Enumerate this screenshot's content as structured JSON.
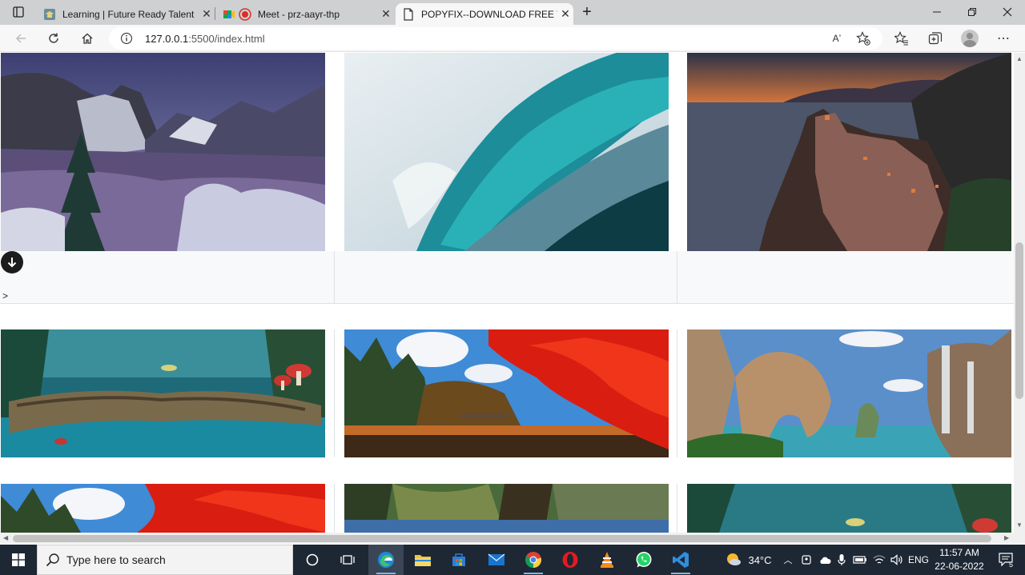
{
  "browser": {
    "tabs": [
      {
        "title": "Learning | Future Ready Talent",
        "favicon": "graduation-favicon",
        "active": false
      },
      {
        "title": "Meet - prz-aayr-thp",
        "favicon": "meet-favicon",
        "active": false,
        "recording": true
      },
      {
        "title": "POPYFIX--DOWNLOAD FREE WA",
        "favicon": "page-favicon",
        "active": true
      }
    ],
    "new_tab_label": "+",
    "url_host": "127.0.0.1",
    "url_rest": ":5500/index.html",
    "read_aloud_label": "Aʼ",
    "window_controls": [
      "minimize-icon",
      "restore-icon",
      "close-icon"
    ]
  },
  "page": {
    "caret_text": ">",
    "rows": [
      {
        "images": [
          "snowy-mountain-valley",
          "ocean-wave",
          "cliffside-village-sunset"
        ]
      },
      {
        "images": [
          "fantasy-mushroom-log",
          "red-autumn-lake",
          "fantasy-rock-waterfall"
        ]
      },
      {
        "images": [
          "red-autumn-lake",
          "forest-lake",
          "fantasy-mushroom-log"
        ]
      }
    ]
  },
  "taskbar": {
    "search_placeholder": "Type here to search",
    "apps": [
      "task-view-icon",
      "edge-icon",
      "file-explorer-icon",
      "store-icon",
      "mail-icon",
      "chrome-icon",
      "opera-icon",
      "vlc-icon",
      "whatsapp-icon",
      "vscode-icon"
    ],
    "weather_temp": "34°C",
    "language": "ENG",
    "time": "11:57 AM",
    "date": "22-06-2022",
    "notification_count": "5"
  },
  "colors": {
    "tabstrip_bg": "#cfd0d2",
    "toolbar_bg": "#f7f7f7",
    "taskbar_bg": "#1e2734",
    "card_strip_bg": "#f8f9fa"
  }
}
